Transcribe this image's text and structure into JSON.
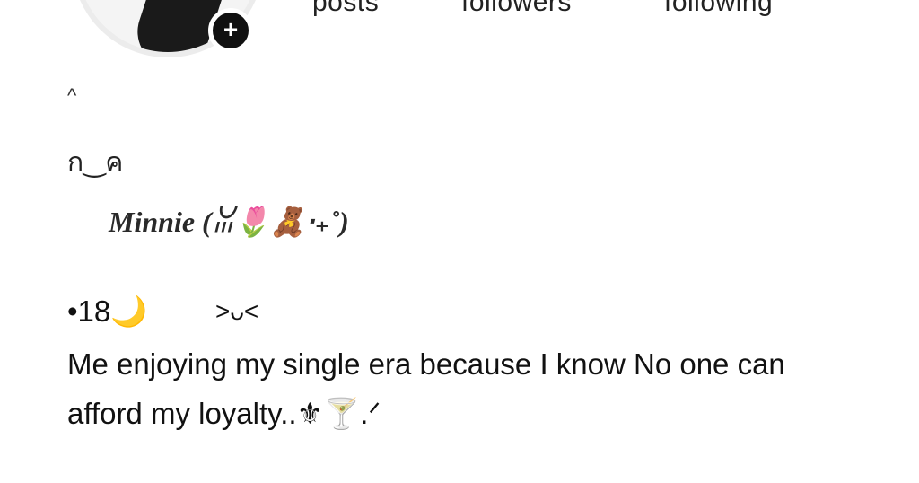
{
  "profile": {
    "add_story_icon": "plus-icon",
    "add_story_symbol": "+"
  },
  "stats": {
    "posts_label": "posts",
    "followers_label": "followers",
    "following_label": "following"
  },
  "bio": {
    "line1": "^",
    "line2": "ก‿ค",
    "name": "Minnie (ꈍ🌷🧸‧₊˚)",
    "age": "•18🌙",
    "face": ">ᴗ<",
    "text": "Me enjoying my single era because I know No one can afford my loyalty..⚜🍸.ᐟ"
  }
}
